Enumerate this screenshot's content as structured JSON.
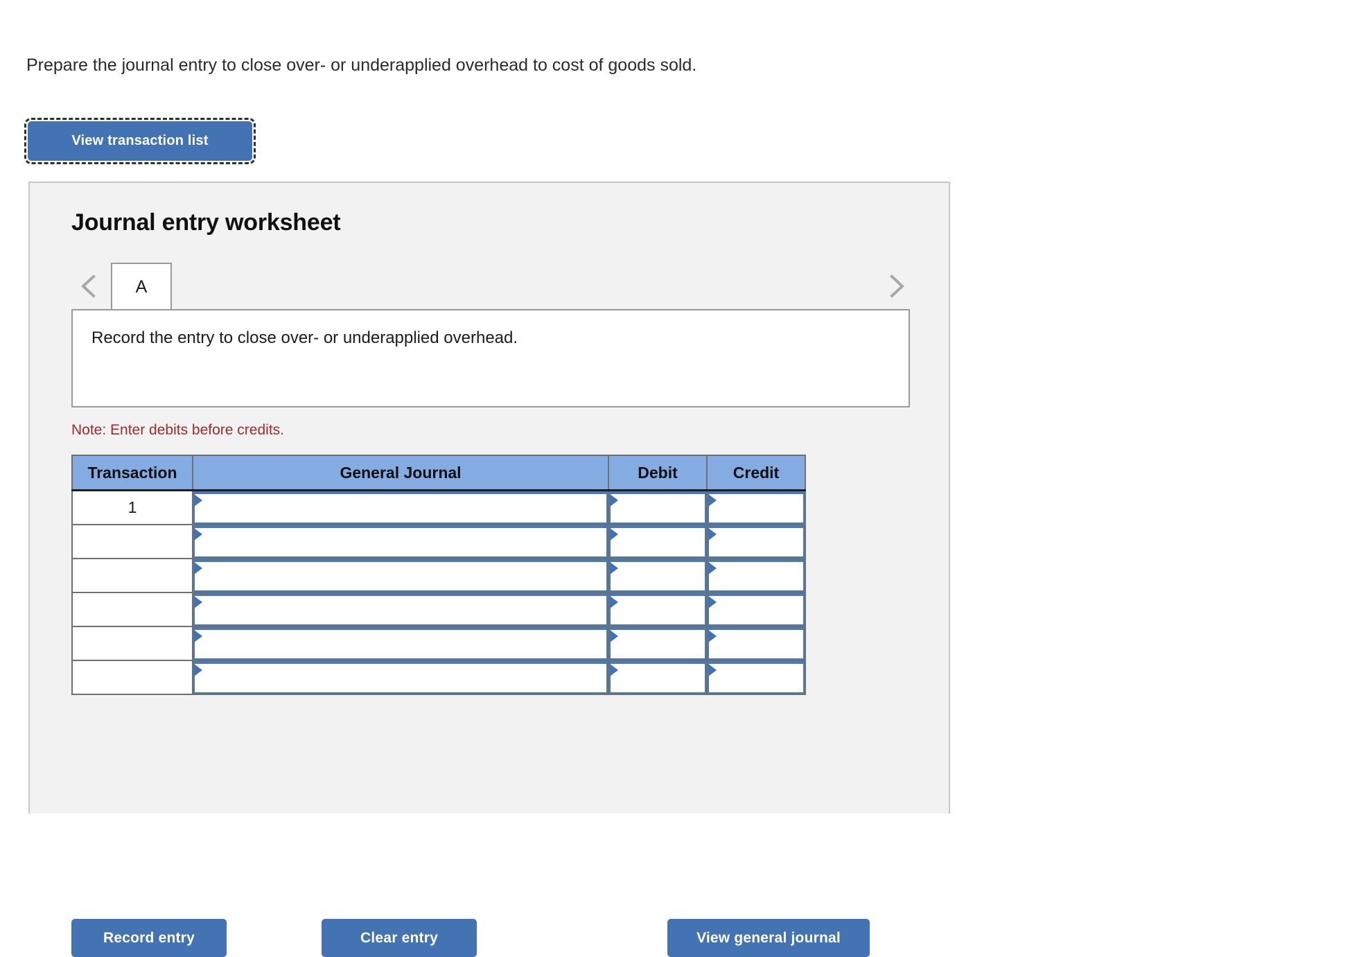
{
  "prompt": "Prepare the journal entry to close over- or underapplied overhead to cost of goods sold.",
  "view_transaction_list_label": "View transaction list",
  "worksheet": {
    "title": "Journal entry worksheet",
    "tabs": [
      {
        "label": "A",
        "active": true
      }
    ],
    "prev_icon": "chevron-left-icon",
    "next_icon": "chevron-right-icon",
    "description": "Record the entry to close over- or underapplied overhead.",
    "note": "Note: Enter debits before credits.",
    "table": {
      "columns": [
        "Transaction",
        "General Journal",
        "Debit",
        "Credit"
      ],
      "rows": [
        {
          "transaction": "1",
          "general_journal": "",
          "debit": "",
          "credit": ""
        },
        {
          "transaction": "",
          "general_journal": "",
          "debit": "",
          "credit": ""
        },
        {
          "transaction": "",
          "general_journal": "",
          "debit": "",
          "credit": ""
        },
        {
          "transaction": "",
          "general_journal": "",
          "debit": "",
          "credit": ""
        },
        {
          "transaction": "",
          "general_journal": "",
          "debit": "",
          "credit": ""
        },
        {
          "transaction": "",
          "general_journal": "",
          "debit": "",
          "credit": ""
        }
      ]
    },
    "actions": {
      "record_entry": "Record entry",
      "clear_entry": "Clear entry",
      "view_general_journal": "View general journal"
    }
  },
  "colors": {
    "button_blue": "#4473b3",
    "header_blue": "#85ace2",
    "field_blue": "#4a7ab5",
    "note_red": "#9e2a2b",
    "panel_gray": "#f2f2f2"
  }
}
